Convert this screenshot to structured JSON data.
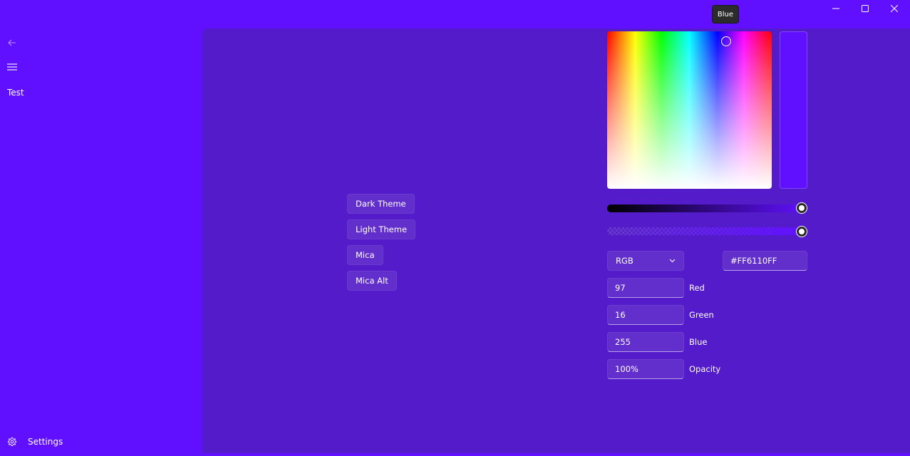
{
  "window": {
    "minimize_icon": "minimize-icon",
    "maximize_icon": "maximize-icon",
    "close_icon": "close-icon"
  },
  "tooltip": {
    "text": "Blue"
  },
  "nav": {
    "back_icon": "back-arrow-icon",
    "menu_icon": "hamburger-icon",
    "items": [
      {
        "label": "Test"
      }
    ],
    "settings": {
      "label": "Settings",
      "icon": "gear-icon"
    }
  },
  "theme_buttons": [
    {
      "label": "Dark Theme"
    },
    {
      "label": "Light Theme"
    },
    {
      "label": "Mica"
    },
    {
      "label": "Mica Alt"
    }
  ],
  "color_picker": {
    "selected_color": "#6110FF",
    "color_model": "RGB",
    "hex_value": "#FF6110FF",
    "value_slider": 1.0,
    "alpha_slider": 1.0,
    "channels": [
      {
        "value": "97",
        "label": "Red"
      },
      {
        "value": "16",
        "label": "Green"
      },
      {
        "value": "255",
        "label": "Blue"
      },
      {
        "value": "100%",
        "label": "Opacity"
      }
    ]
  },
  "colors": {
    "window_background": "#6110FF",
    "content_background": "#531BC9",
    "tooltip_background": "#2B2B2B"
  }
}
